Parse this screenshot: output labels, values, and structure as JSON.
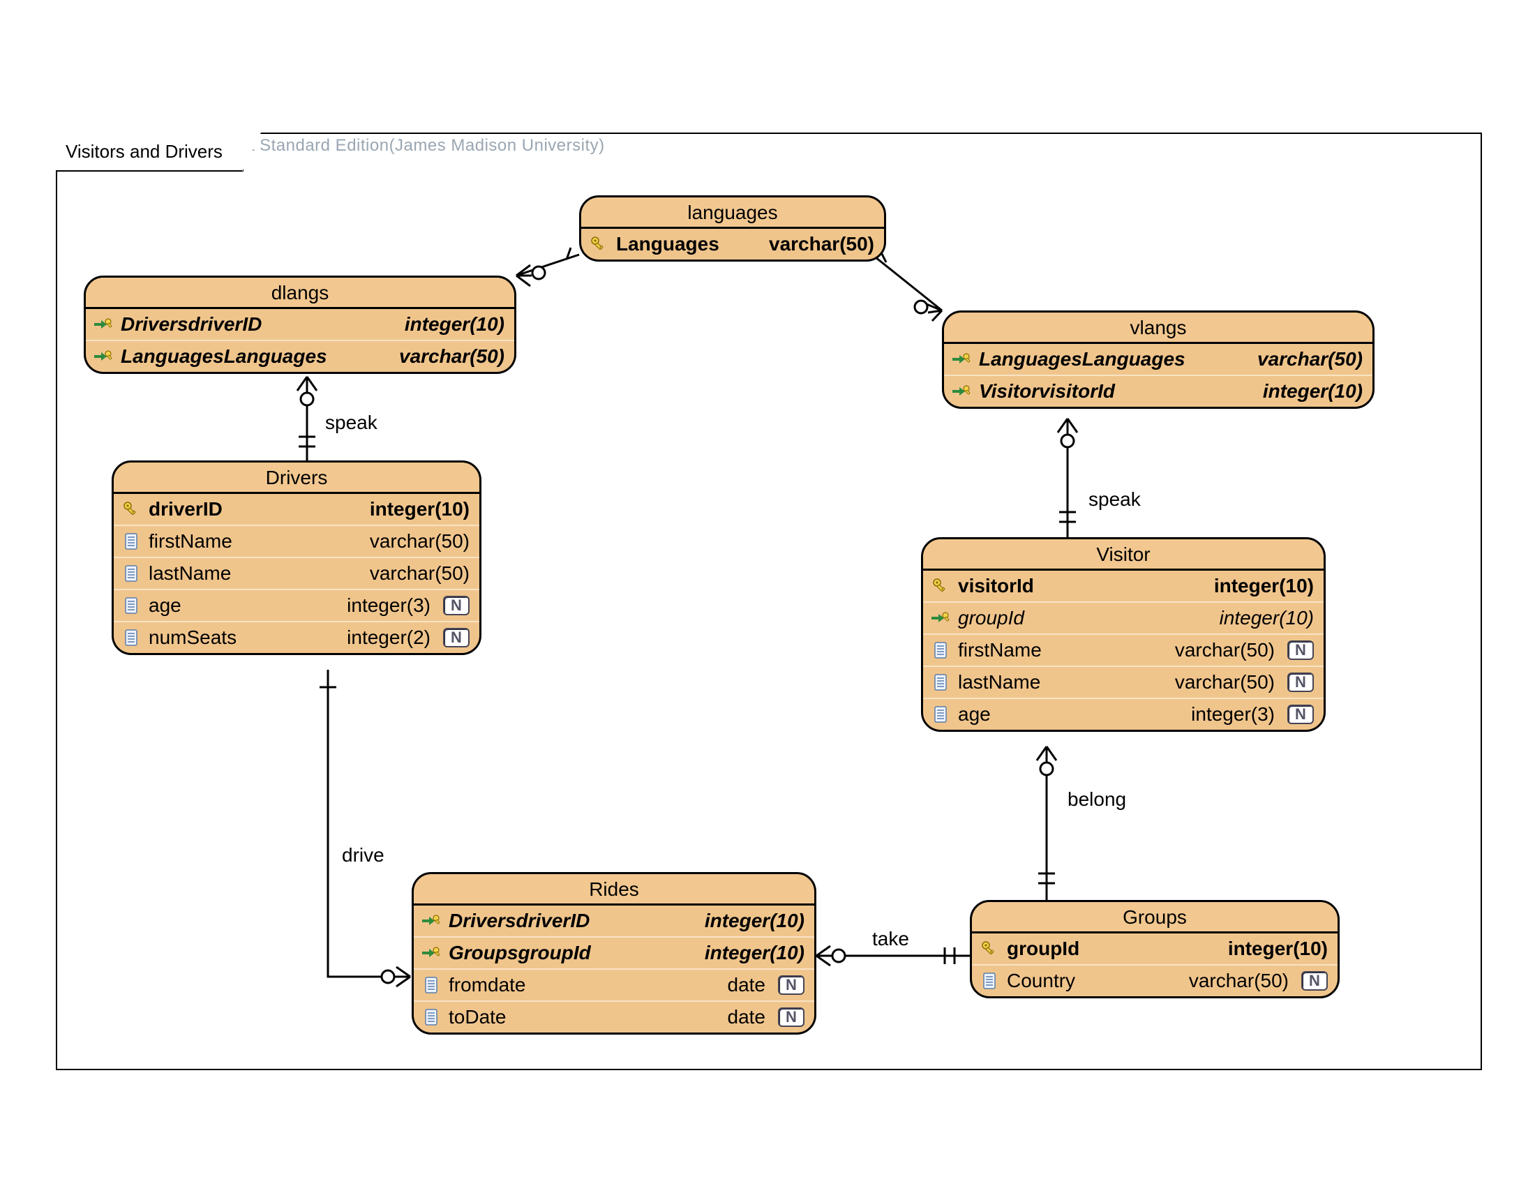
{
  "watermark": "Visual Paradigm for UML Standard Edition(James Madison University)",
  "frame_title": "Visitors and Drivers",
  "icons": {
    "pk": "primary-key-icon",
    "fk": "foreign-key-icon",
    "col": "column-icon",
    "null": "nullable-badge"
  },
  "entities": {
    "languages": {
      "title": "languages",
      "rows": [
        {
          "icon": "pk",
          "name": "Languages",
          "type": "varchar(50)",
          "bold": true
        }
      ]
    },
    "dlangs": {
      "title": "dlangs",
      "rows": [
        {
          "icon": "fk",
          "name": "DriversdriverID",
          "type": "integer(10)",
          "bold": true,
          "italic": true
        },
        {
          "icon": "fk",
          "name": "LanguagesLanguages",
          "type": "varchar(50)",
          "bold": true,
          "italic": true
        }
      ]
    },
    "vlangs": {
      "title": "vlangs",
      "rows": [
        {
          "icon": "fk",
          "name": "LanguagesLanguages",
          "type": "varchar(50)",
          "bold": true,
          "italic": true
        },
        {
          "icon": "fk",
          "name": "VisitorvisitorId",
          "type": "integer(10)",
          "bold": true,
          "italic": true
        }
      ]
    },
    "drivers": {
      "title": "Drivers",
      "rows": [
        {
          "icon": "pk",
          "name": "driverID",
          "type": "integer(10)",
          "bold": true
        },
        {
          "icon": "col",
          "name": "firstName",
          "type": "varchar(50)"
        },
        {
          "icon": "col",
          "name": "lastName",
          "type": "varchar(50)"
        },
        {
          "icon": "col",
          "name": "age",
          "type": "integer(3)",
          "nullable": true
        },
        {
          "icon": "col",
          "name": "numSeats",
          "type": "integer(2)",
          "nullable": true
        }
      ]
    },
    "visitor": {
      "title": "Visitor",
      "rows": [
        {
          "icon": "pk",
          "name": "visitorId",
          "type": "integer(10)",
          "bold": true
        },
        {
          "icon": "fk",
          "name": "groupId",
          "type": "integer(10)",
          "italic": true
        },
        {
          "icon": "col",
          "name": "firstName",
          "type": "varchar(50)",
          "nullable": true
        },
        {
          "icon": "col",
          "name": "lastName",
          "type": "varchar(50)",
          "nullable": true
        },
        {
          "icon": "col",
          "name": "age",
          "type": "integer(3)",
          "nullable": true
        }
      ]
    },
    "rides": {
      "title": "Rides",
      "rows": [
        {
          "icon": "fk",
          "name": "DriversdriverID",
          "type": "integer(10)",
          "bold": true,
          "italic": true
        },
        {
          "icon": "fk",
          "name": "GroupsgroupId",
          "type": "integer(10)",
          "bold": true,
          "italic": true
        },
        {
          "icon": "col",
          "name": "fromdate",
          "type": "date",
          "nullable": true
        },
        {
          "icon": "col",
          "name": "toDate",
          "type": "date",
          "nullable": true
        }
      ]
    },
    "groups": {
      "title": "Groups",
      "rows": [
        {
          "icon": "pk",
          "name": "groupId",
          "type": "integer(10)",
          "bold": true
        },
        {
          "icon": "col",
          "name": "Country",
          "type": "varchar(50)",
          "nullable": true
        }
      ]
    }
  },
  "relationships": {
    "speak_dlangs_drivers": "speak",
    "speak_vlangs_visitor": "speak",
    "drive_drivers_rides": "drive",
    "take_rides_groups": "take",
    "belong_visitor_groups": "belong"
  },
  "nullable_badge": "N"
}
